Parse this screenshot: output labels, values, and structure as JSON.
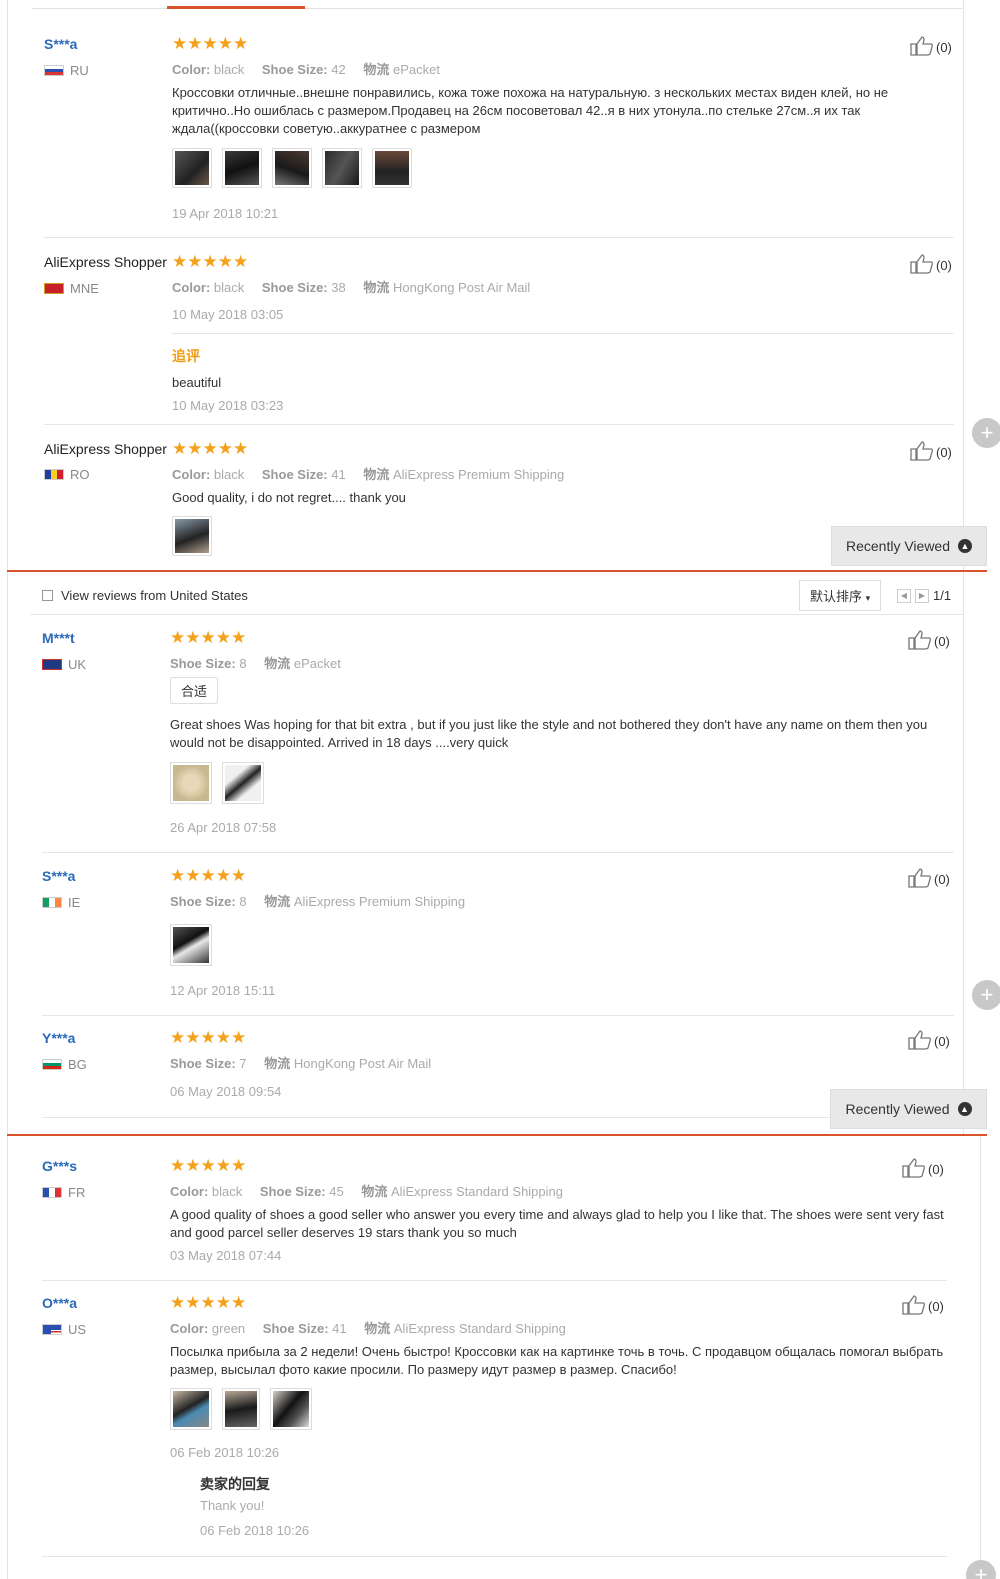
{
  "like_count": "(0)",
  "recently_viewed": "Recently Viewed",
  "attr_labels": {
    "color": "Color:",
    "size": "Shoe Size:",
    "logistics": "物流"
  },
  "panel1": {
    "reviews": [
      {
        "name": "S***a",
        "country": "RU",
        "stars": "★★★★★",
        "color": "black",
        "size": "42",
        "shipping": "ePacket",
        "text": "Кроссовки отличные..внешне понравились, кожа тоже похожа на натуральную. з нескольких местах виден клей, но не критично..Но ошиблась с размером.Продавец на 26см посоветовал 42..я в них утонула..по стельке 27см..я их так ждала((кроссовки советую..аккуратнее с размером",
        "date": "19 Apr 2018 10:21"
      },
      {
        "name": "AliExpress Shopper",
        "country": "MNE",
        "stars": "★★★★★",
        "color": "black",
        "size": "38",
        "shipping": "HongKong Post Air Mail",
        "date": "10 May 2018 03:05",
        "followup_label": "追评",
        "followup_text": "beautiful",
        "followup_date": "10 May 2018 03:23"
      },
      {
        "name": "AliExpress Shopper",
        "country": "RO",
        "stars": "★★★★★",
        "color": "black",
        "size": "41",
        "shipping": "AliExpress Premium Shipping",
        "text": "Good quality, i do not regret.... thank you"
      }
    ]
  },
  "panel2": {
    "filter_label": "View reviews from United States",
    "sort_label": "默认排序",
    "page": "1/1",
    "reviews": [
      {
        "name": "M***t",
        "country": "UK",
        "stars": "★★★★★",
        "size": "8",
        "shipping": "ePacket",
        "tag": "合适",
        "text": "Great shoes Was hoping for that bit extra , but if you just like the style and not bothered they don't have any name on them then you would not be disappointed. Arrived in 18 days ....very quick",
        "date": "26 Apr 2018 07:58"
      },
      {
        "name": "S***a",
        "country": "IE",
        "stars": "★★★★★",
        "size": "8",
        "shipping": "AliExpress Premium Shipping",
        "date": "12 Apr 2018 15:11"
      },
      {
        "name": "Y***a",
        "country": "BG",
        "stars": "★★★★★",
        "size": "7",
        "shipping": "HongKong Post Air Mail",
        "date": "06 May 2018 09:54"
      }
    ]
  },
  "panel3": {
    "reviews": [
      {
        "name": "G***s",
        "country": "FR",
        "stars": "★★★★★",
        "color": "black",
        "size": "45",
        "shipping": "AliExpress Standard Shipping",
        "text": "A good quality of shoes a good seller who answer you every time and always glad to help you I like that. The shoes were sent very fast and good parcel seller deserves 19 stars thank you so much",
        "date": "03 May 2018 07:44"
      },
      {
        "name": "O***a",
        "country": "US",
        "stars": "★★★★★",
        "color": "green",
        "size": "41",
        "shipping": "AliExpress Standard Shipping",
        "text": "Посылка прибыла за 2 недели! Очень быстро! Кроссовки как на картинке точь в точь. С продавцом общалась помогал выбрать размер, высылал фото какие просили. По размеру идут размер в размер. Спасибо!",
        "date": "06 Feb 2018 10:26",
        "seller_reply_title": "卖家的回复",
        "seller_reply_text": "Thank you!",
        "seller_reply_date": "06 Feb 2018 10:26"
      }
    ]
  }
}
